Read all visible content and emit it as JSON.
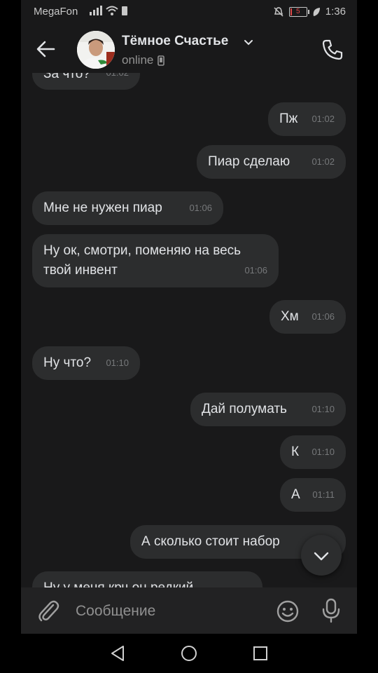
{
  "status_bar": {
    "carrier": "MegaFon",
    "battery_level": "5",
    "time": "1:36"
  },
  "header": {
    "contact_name": "Тёмное Счастье",
    "status": "online"
  },
  "messages": [
    {
      "side": "in",
      "text": "За что?",
      "time": "01:02"
    },
    {
      "side": "out",
      "text": "Пж",
      "time": "01:02"
    },
    {
      "side": "out",
      "text": "Пиар сделаю",
      "time": "01:02"
    },
    {
      "side": "in",
      "text": "Мне не нужен пиар",
      "time": "01:06"
    },
    {
      "side": "in",
      "text": "Ну ок, смотри, поменяю на весь твой инвент",
      "time": "01:06"
    },
    {
      "side": "out",
      "text": "Хм",
      "time": "01:06"
    },
    {
      "side": "in",
      "text": "Ну что?",
      "time": "01:10"
    },
    {
      "side": "out",
      "text": "Дай полумать",
      "time": "01:10"
    },
    {
      "side": "out",
      "text": "К",
      "time": "01:10"
    },
    {
      "side": "out",
      "text": "А",
      "time": "01:11"
    },
    {
      "side": "out",
      "text": "А сколько стоит набор",
      "time": ""
    },
    {
      "side": "in",
      "text": "Ну у меня крч он редкий",
      "time": ""
    }
  ],
  "composer": {
    "placeholder": "Сообщение"
  },
  "icons": {
    "back": "arrow-left-icon",
    "call": "phone-icon",
    "attach": "paperclip-icon",
    "emoji": "smile-icon",
    "mic": "microphone-icon",
    "scroll_down": "chevron-down-icon"
  },
  "colors": {
    "background": "#19191a",
    "bubble": "#2c2d2e",
    "text": "#e1e3e6",
    "time": "#76787a"
  }
}
